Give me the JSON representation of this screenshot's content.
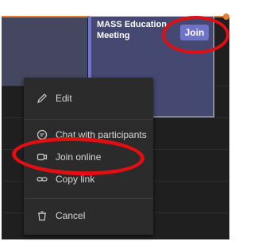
{
  "event": {
    "title": "MASS Education Meeting",
    "join_label": "Join"
  },
  "menu": {
    "edit": "Edit",
    "chat": "Chat with participants",
    "join_online": "Join online",
    "copy_link": "Copy link",
    "cancel": "Cancel"
  },
  "icons": {
    "edit": "pencil-icon",
    "chat": "chat-icon",
    "join_online": "video-camera-icon",
    "copy_link": "link-icon",
    "cancel": "trash-icon"
  },
  "colors": {
    "accent": "#6f73c8",
    "highlight": "#e10f13",
    "current_time": "#e87b2d"
  }
}
